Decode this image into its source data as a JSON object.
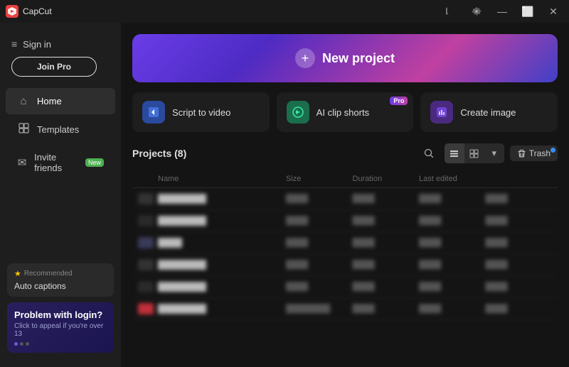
{
  "app": {
    "name": "CapCut",
    "logo_text": "C"
  },
  "titlebar": {
    "controls": [
      "chat-icon",
      "settings-icon",
      "minimize-icon",
      "maximize-icon",
      "close-icon"
    ]
  },
  "sidebar": {
    "signin_label": "Sign in",
    "join_pro_label": "Join Pro",
    "nav_items": [
      {
        "id": "home",
        "label": "Home",
        "icon": "⌂",
        "active": true
      },
      {
        "id": "templates",
        "label": "Templates",
        "icon": "☰",
        "active": false
      },
      {
        "id": "invite",
        "label": "Invite friends",
        "icon": "✉",
        "badge": "New",
        "active": false
      }
    ],
    "recommendation": {
      "prefix": "Recommended",
      "name": "Auto captions"
    },
    "problem_card": {
      "title": "Problem with login?",
      "subtitle": "Click to appeal if you're over 13"
    }
  },
  "main": {
    "new_project": {
      "label": "New project",
      "plus": "+"
    },
    "action_cards": [
      {
        "id": "script-to-video",
        "label": "Script to video",
        "icon": "▶",
        "icon_type": "script",
        "pro": false
      },
      {
        "id": "ai-clip-shorts",
        "label": "AI clip shorts",
        "icon": "✦",
        "icon_type": "clip",
        "pro": true
      },
      {
        "id": "create-image",
        "label": "Create image",
        "icon": "⬡",
        "icon_type": "create",
        "pro": false
      }
    ],
    "projects": {
      "title": "Projects",
      "count": 8,
      "title_full": "Projects  (8)",
      "trash_label": "Trash",
      "table_headers": [
        "",
        "Name",
        "Size",
        "Duration",
        "Last edited"
      ],
      "rows": [
        {
          "thumb_color": "#333",
          "name": "...",
          "size": "...",
          "duration": "...",
          "edited": "..."
        },
        {
          "thumb_color": "#2a2a2a",
          "name": "...",
          "size": "...",
          "duration": "...",
          "edited": "..."
        },
        {
          "thumb_color": "#3a3a4a",
          "name": "...",
          "size": "...",
          "duration": "...",
          "edited": "..."
        },
        {
          "thumb_color": "#333",
          "name": "...",
          "size": "...",
          "duration": "...",
          "edited": "..."
        },
        {
          "thumb_color": "#2a2a2a",
          "name": "...",
          "size": "...",
          "duration": "...",
          "edited": "..."
        },
        {
          "thumb_color": "#c0303a",
          "name": "...",
          "size": "...",
          "duration": "...",
          "edited": "..."
        }
      ]
    }
  },
  "colors": {
    "accent": "#6a3de8",
    "pro_badge": "#c040a0",
    "trash_dot": "#3a8ef0",
    "new_badge": "#4caf50"
  }
}
